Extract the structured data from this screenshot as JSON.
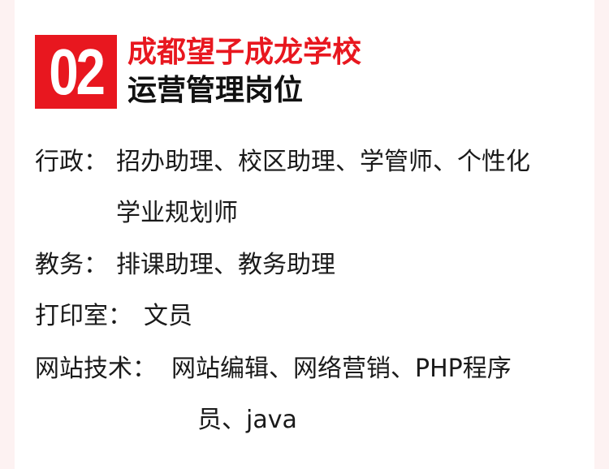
{
  "header": {
    "badge_number": "02",
    "title_red": "成都望子成龙学校",
    "title_black": "运营管理岗位"
  },
  "sections": [
    {
      "label": "行政：",
      "lines": [
        "招办助理、校区助理、学管师、个性化",
        "学业规划师"
      ]
    },
    {
      "label": "教务：",
      "lines": [
        "排课助理、教务助理"
      ]
    },
    {
      "label": "打印室：",
      "lines": [
        "文员"
      ]
    },
    {
      "label": "网站技术：",
      "lines": [
        "网站编辑、网络营销、PHP程序",
        "员、java"
      ]
    }
  ]
}
